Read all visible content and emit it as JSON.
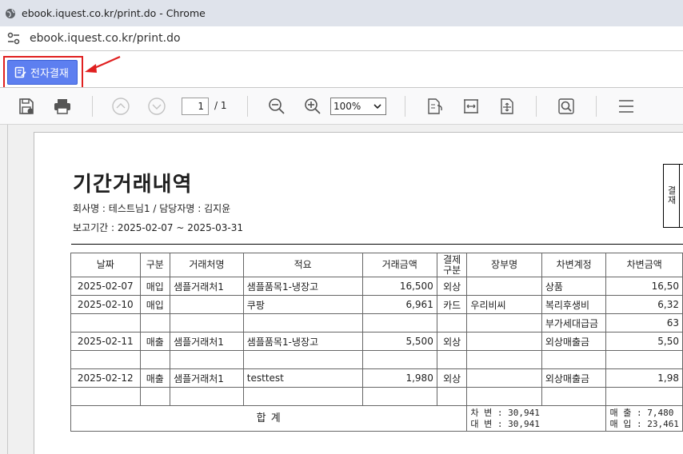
{
  "window": {
    "title": "ebook.iquest.co.kr/print.do - Chrome",
    "url": "ebook.iquest.co.kr/print.do"
  },
  "action_button": {
    "label": "전자결재"
  },
  "pdf_toolbar": {
    "page_current": "1",
    "page_total": "/ 1",
    "zoom": "100%"
  },
  "document": {
    "title": "기간거래내역",
    "company_line": "회사명 : 테스트님1 / 담당자명 : 김지윤",
    "period_line": "보고기간 : 2025-02-07 ~ 2025-03-31",
    "stamp_label": "결재",
    "headers": [
      "날짜",
      "구분",
      "거래처명",
      "적요",
      "거래금액",
      "결제\n구분",
      "장부명",
      "차변계정",
      "차변금액"
    ],
    "rows": [
      [
        "2025-02-07",
        "매입",
        "샘플거래처1",
        "샘플품목1-냉장고",
        "16,500",
        "외상",
        "",
        "상품",
        "16,50"
      ],
      [
        "2025-02-10",
        "매입",
        "",
        "쿠팡",
        "6,961",
        "카드",
        "우리비씨",
        "복리후생비",
        "6,32"
      ],
      [
        "",
        "",
        "",
        "",
        "",
        "",
        "",
        "부가세대급금",
        "63"
      ],
      [
        "2025-02-11",
        "매출",
        "샘플거래처1",
        "샘플품목1-냉장고",
        "5,500",
        "외상",
        "",
        "외상매출금",
        "5,50"
      ],
      [
        "",
        "",
        "",
        "",
        "",
        "",
        "",
        "",
        ""
      ],
      [
        "2025-02-12",
        "매출",
        "샘플거래처1",
        "testtest",
        "1,980",
        "외상",
        "",
        "외상매출금",
        "1,98"
      ],
      [
        "",
        "",
        "",
        "",
        "",
        "",
        "",
        "",
        ""
      ]
    ],
    "summary": {
      "label": "합   계",
      "debit": "차 변 : 30,941",
      "credit": "대 변 : 30,941",
      "sales": "매 출 : 7,480",
      "purchase": "매 입 : 23,461"
    }
  }
}
